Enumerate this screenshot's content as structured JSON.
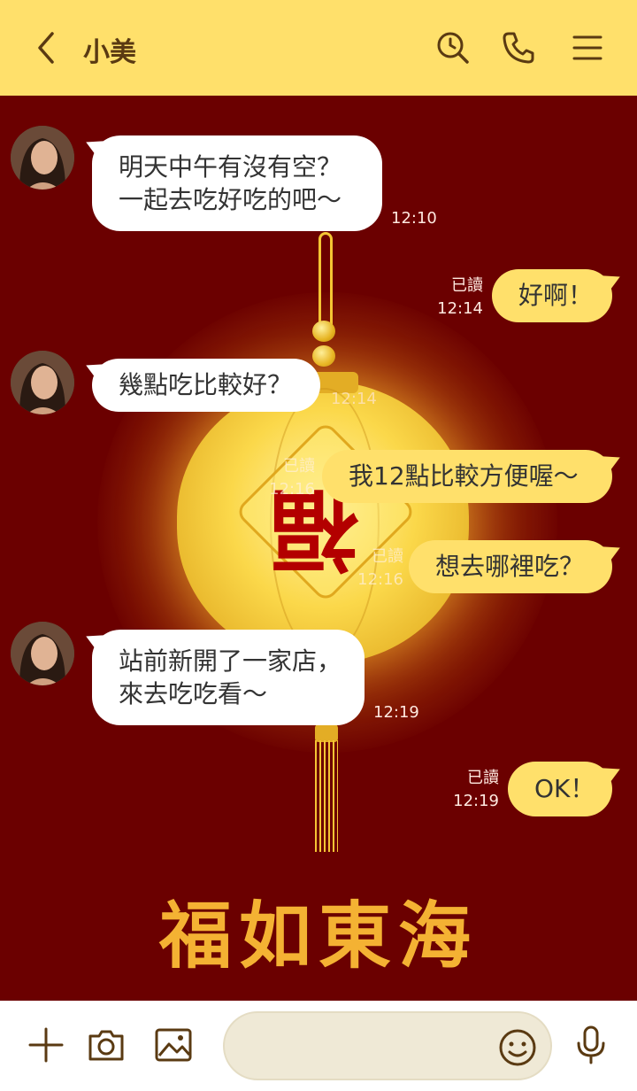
{
  "header": {
    "title": "小美"
  },
  "chat": {
    "messages": [
      {
        "from": "in",
        "text": "明天中午有沒有空？\n一起去吃好吃的吧～",
        "time": "12:10"
      },
      {
        "from": "out",
        "text": "好啊！",
        "read": "已讀",
        "time": "12:14"
      },
      {
        "from": "in",
        "text": "幾點吃比較好？",
        "time": "12:14"
      },
      {
        "from": "out",
        "text": "我12點比較方便喔～",
        "read": "已讀",
        "time": "12:16"
      },
      {
        "from": "out",
        "text": "想去哪裡吃？",
        "read": "已讀",
        "time": "12:16"
      },
      {
        "from": "in",
        "text": "站前新開了一家店，\n來去吃吃看～",
        "time": "12:19"
      },
      {
        "from": "out",
        "text": "OK！",
        "read": "已讀",
        "time": "12:19"
      }
    ]
  },
  "background": {
    "fu_char": "福",
    "motto": "福如東海"
  },
  "footer": {
    "input_placeholder": ""
  },
  "colors": {
    "header": "#ffe06b",
    "background": "#6b0000",
    "accent_text": "#5a3a12",
    "gold": "#f4b233"
  },
  "icons": [
    "back-icon",
    "search-clock-icon",
    "phone-icon",
    "menu-icon",
    "plus-icon",
    "camera-icon",
    "image-icon",
    "emoji-icon",
    "mic-icon"
  ]
}
